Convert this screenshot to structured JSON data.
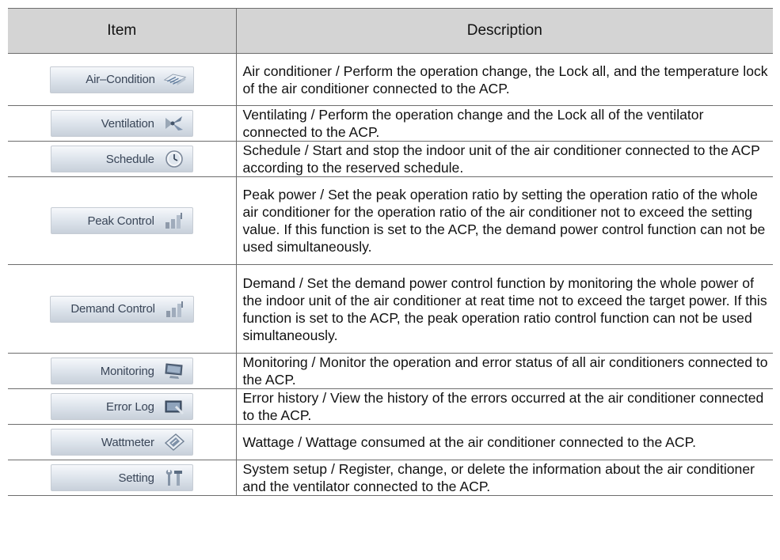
{
  "table": {
    "headers": {
      "item": "Item",
      "description": "Description"
    },
    "rows": [
      {
        "button_label": "Air–Condition",
        "icon": "air-conditioner-icon",
        "description": "Air conditioner / Perform the operation change, the Lock all, and the temperature lock of the air conditioner connected to the ACP."
      },
      {
        "button_label": "Ventilation",
        "icon": "ventilation-fan-icon",
        "description": "Ventilating / Perform the operation change and the Lock all of the ventilator connected to the ACP."
      },
      {
        "button_label": "Schedule",
        "icon": "clock-icon",
        "description": "Schedule / Start and stop the indoor unit of the air conditioner connected to the ACP according to the reserved schedule."
      },
      {
        "button_label": "Peak Control",
        "icon": "signal-bars-icon",
        "description": "Peak power / Set the peak operation ratio by setting the operation ratio of the whole air conditioner for the operation ratio of the air conditioner not to exceed the setting value. If this function is set to the ACP, the demand power control function can not be used simultaneously."
      },
      {
        "button_label": "Demand Control",
        "icon": "signal-bars-icon",
        "description": "Demand / Set the demand power control function by monitoring the whole power of the indoor unit of the air conditioner at reat time not to exceed the target power. If this function is set to the ACP, the peak operation ratio control function can not be used simultaneously."
      },
      {
        "button_label": "Monitoring",
        "icon": "monitor-icon",
        "description": "Monitoring / Monitor the operation and error status of all air conditioners connected to the ACP."
      },
      {
        "button_label": "Error Log",
        "icon": "error-log-icon",
        "description": "Error history / View the history of the errors occurred at the air conditioner connected to the ACP."
      },
      {
        "button_label": "Wattmeter",
        "icon": "wattmeter-icon",
        "description": "Wattage / Wattage consumed at the air conditioner connected to the ACP."
      },
      {
        "button_label": "Setting",
        "icon": "tools-icon",
        "description": "System setup / Register, change, or delete the information about the air conditioner and the ventilator connected to the ACP."
      }
    ]
  }
}
